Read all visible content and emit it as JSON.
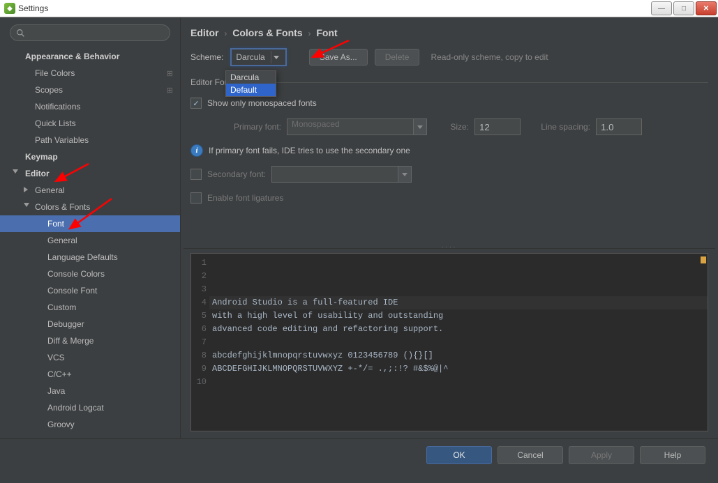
{
  "title": "Settings",
  "breadcrumb": {
    "a": "Editor",
    "b": "Colors & Fonts",
    "c": "Font"
  },
  "sidebar": {
    "groups": [
      {
        "label": "Appearance & Behavior",
        "kind": "h1"
      },
      {
        "label": "File Colors",
        "kind": "item",
        "cfg": true
      },
      {
        "label": "Scopes",
        "kind": "item",
        "cfg": true
      },
      {
        "label": "Notifications",
        "kind": "item"
      },
      {
        "label": "Quick Lists",
        "kind": "item"
      },
      {
        "label": "Path Variables",
        "kind": "item"
      },
      {
        "label": "Keymap",
        "kind": "h1"
      },
      {
        "label": "Editor",
        "kind": "h1",
        "arrow": "open"
      },
      {
        "label": "General",
        "kind": "lvl2",
        "arrow": "closed"
      },
      {
        "label": "Colors & Fonts",
        "kind": "lvl2",
        "arrow": "open"
      },
      {
        "label": "Font",
        "kind": "lvl3",
        "sel": true
      },
      {
        "label": "General",
        "kind": "lvl3"
      },
      {
        "label": "Language Defaults",
        "kind": "lvl3"
      },
      {
        "label": "Console Colors",
        "kind": "lvl3"
      },
      {
        "label": "Console Font",
        "kind": "lvl3"
      },
      {
        "label": "Custom",
        "kind": "lvl3"
      },
      {
        "label": "Debugger",
        "kind": "lvl3"
      },
      {
        "label": "Diff & Merge",
        "kind": "lvl3"
      },
      {
        "label": "VCS",
        "kind": "lvl3"
      },
      {
        "label": "C/C++",
        "kind": "lvl3"
      },
      {
        "label": "Java",
        "kind": "lvl3"
      },
      {
        "label": "Android Logcat",
        "kind": "lvl3"
      },
      {
        "label": "Groovy",
        "kind": "lvl3"
      }
    ]
  },
  "scheme": {
    "label": "Scheme:",
    "value": "Darcula",
    "options": [
      "Darcula",
      "Default"
    ],
    "saveAs": "Save As...",
    "delete": "Delete",
    "hint": "Read-only scheme, copy to edit"
  },
  "editorFont": {
    "section": "Editor Font",
    "showMono": "Show only monospaced fonts",
    "primaryLabel": "Primary font:",
    "primaryValue": "Monospaced",
    "sizeLabel": "Size:",
    "sizeValue": "12",
    "spacingLabel": "Line spacing:",
    "spacingValue": "1.0",
    "info": "If primary font fails, IDE tries to use the secondary one",
    "secondaryLabel": "Secondary font:",
    "ligatures": "Enable font ligatures"
  },
  "preview": {
    "lines": [
      "Android Studio is a full-featured IDE",
      "with a high level of usability and outstanding",
      "advanced code editing and refactoring support.",
      "",
      "abcdefghijklmnopqrstuvwxyz 0123456789 (){}[]",
      "ABCDEFGHIJKLMNOPQRSTUVWXYZ +-*/= .,;:!? #&$%@|^",
      "",
      "",
      "",
      ""
    ]
  },
  "footer": {
    "ok": "OK",
    "cancel": "Cancel",
    "apply": "Apply",
    "help": "Help"
  }
}
